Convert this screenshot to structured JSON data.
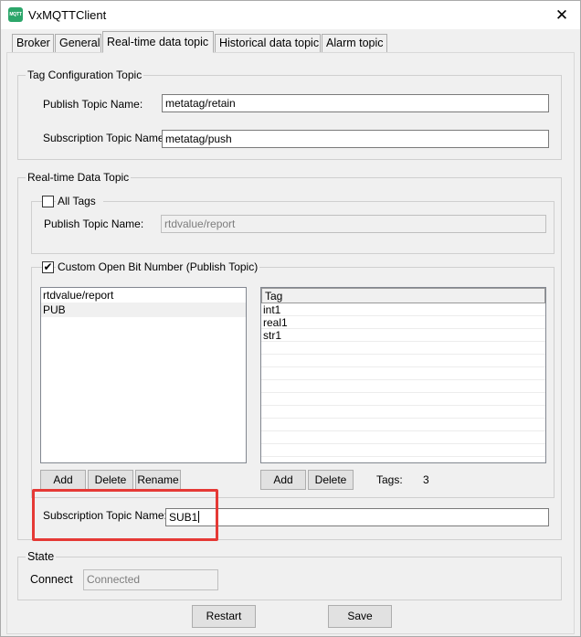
{
  "window": {
    "title": "VxMQTTClient",
    "icon_text": "MQTT"
  },
  "tabs": [
    {
      "label": "Broker"
    },
    {
      "label": "General"
    },
    {
      "label": "Real-time data topic"
    },
    {
      "label": "Historical data topic"
    },
    {
      "label": "Alarm topic"
    }
  ],
  "tag_config": {
    "legend": "Tag Configuration Topic",
    "publish_label": "Publish Topic Name:",
    "publish_value": "metatag/retain",
    "subscription_label": "Subscription Topic Name:",
    "subscription_value": "metatag/push"
  },
  "realtime": {
    "legend": "Real-time Data Topic",
    "all_tags": {
      "label": "All Tags",
      "checked": false,
      "publish_label": "Publish Topic Name:",
      "publish_value": "rtdvalue/report"
    },
    "custom": {
      "label": "Custom Open Bit Number (Publish Topic)",
      "checked": true,
      "topics": [
        "rtdvalue/report",
        "PUB"
      ],
      "tag_header": "Tag",
      "tags": [
        "int1",
        "real1",
        "str1"
      ],
      "add_label": "Add",
      "delete_label": "Delete",
      "rename_label": "Rename",
      "tag_add_label": "Add",
      "tag_delete_label": "Delete",
      "tags_count_label": "Tags:",
      "tags_count": "3"
    },
    "subscription_label": "Subscription Topic Name:",
    "subscription_value": "SUB1"
  },
  "state": {
    "legend": "State",
    "connect_label": "Connect",
    "connect_value": "Connected"
  },
  "footer": {
    "restart_label": "Restart",
    "save_label": "Save"
  },
  "colors": {
    "highlight": "#e53935",
    "icon": "#2ca66a"
  }
}
